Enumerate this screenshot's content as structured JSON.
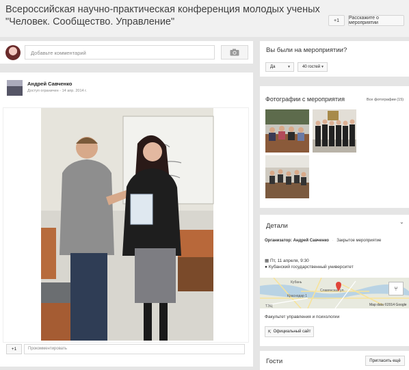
{
  "event": {
    "title": "Всероссийская научно-практическая конференция молодых ученых \"Человек. Сообщество. Управление\"",
    "plus_one": "+1",
    "share_label": "Расскажите о мероприятии"
  },
  "comment_box": {
    "placeholder": "Добавьте комментарий",
    "camera_icon": "camera-icon"
  },
  "post": {
    "author": "Андрей Савченко",
    "meta": "Доступ ограничен - 14 апр. 2014 г.",
    "plus_one": "+1",
    "comment_placeholder": "Прокомментировать"
  },
  "rsvp": {
    "question": "Вы были на мероприятии?",
    "answer": "Да",
    "guests": "40 гостей"
  },
  "photos": {
    "title": "Фотографии с мероприятия",
    "all_link": "Все фотографии (15)"
  },
  "details": {
    "title": "Детали",
    "organizer_label": "Организатор:",
    "organizer_name": "Андрей Савченко",
    "status": "Закрытое мероприятие",
    "date": "Пт, 11 апреля, 9:30",
    "place": "Кубанский государственный университет",
    "map_labels": [
      "Кубань",
      "Краснодар 1",
      "Славянская ул.",
      "ТЭЦ"
    ],
    "map_credit": "Map data ©2014 Google",
    "faculty": "Факультет управления и психологии",
    "site_label": "Официальный сайт"
  },
  "guests": {
    "title": "Гости",
    "invite_label": "Пригласить ещё"
  }
}
